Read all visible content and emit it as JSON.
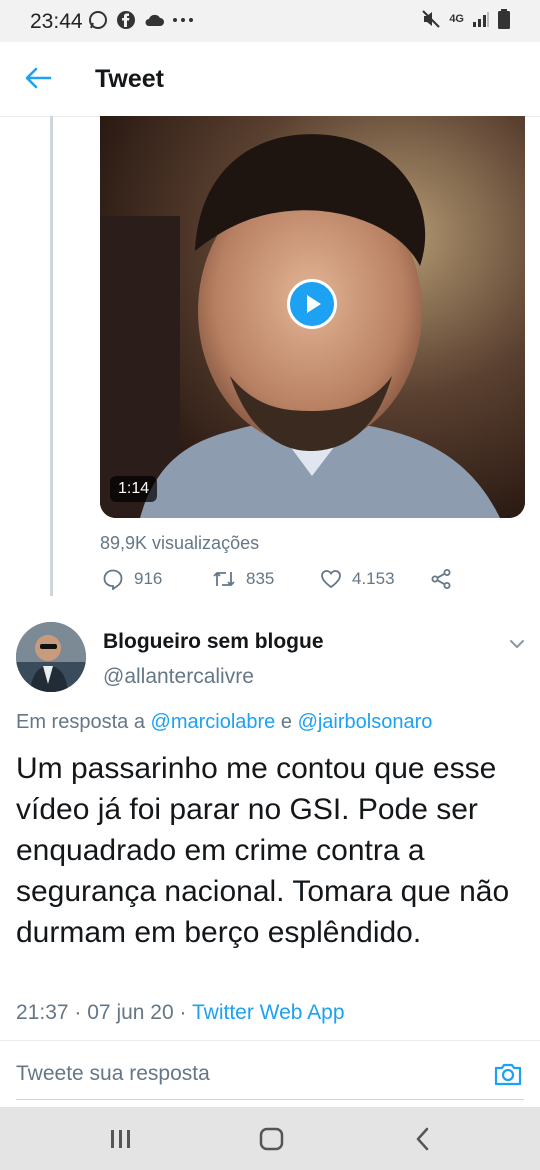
{
  "status_bar": {
    "time": "23:44",
    "left_icons": [
      "whatsapp-icon",
      "facebook-icon",
      "cloud-icon",
      "more-dots-icon"
    ],
    "right_icons": [
      "mute-icon",
      "4g-data-icon",
      "signal-icon",
      "battery-icon"
    ],
    "network_label": "4G"
  },
  "header": {
    "title": "Tweet"
  },
  "video": {
    "duration": "1:14"
  },
  "stats": {
    "views": "89,9K visualizações",
    "replies": "916",
    "retweets": "835",
    "likes": "4.153"
  },
  "reply_tweet": {
    "author_name": "Blogueiro sem blogue",
    "author_handle": "@allantercalivre",
    "in_reply_prefix": "Em resposta a",
    "mention_1": "@marciolabre",
    "conjunction": "e",
    "mention_2": "@jairbolsonaro",
    "text": "Um passarinho me contou que esse vídeo já foi parar no GSI. Pode ser enquadrado em crime contra a segurança nacional. Tomara que não durmam em berço esplêndido.",
    "time": "21:37",
    "date": "07 jun 20",
    "separator": "·",
    "source": "Twitter Web App"
  },
  "compose": {
    "placeholder": "Tweete sua resposta"
  },
  "colors": {
    "accent": "#1da1f2",
    "secondary_text": "#657786",
    "primary_text": "#14171a"
  }
}
